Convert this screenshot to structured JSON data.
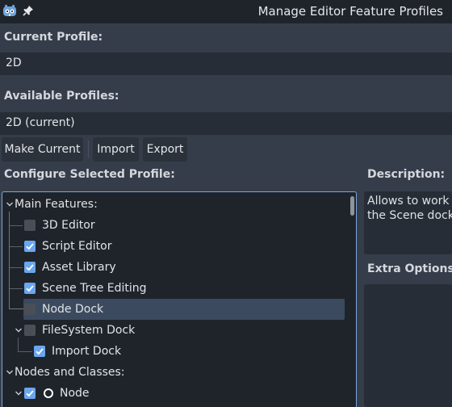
{
  "window": {
    "title": "Manage Editor Feature Profiles",
    "app_icon": "godot-icon",
    "pin_icon": "pin-icon"
  },
  "current_profile": {
    "label": "Current Profile:",
    "value": "2D"
  },
  "available_profiles": {
    "label": "Available Profiles:",
    "selected": "2D (current)",
    "buttons": {
      "make_current": "Make Current",
      "import": "Import",
      "export": "Export"
    }
  },
  "configure": {
    "label": "Configure Selected Profile:",
    "tree": [
      {
        "label": "Main Features:",
        "type": "section",
        "expanded": true
      },
      {
        "label": "3D Editor",
        "checked": false
      },
      {
        "label": "Script Editor",
        "checked": true
      },
      {
        "label": "Asset Library",
        "checked": true
      },
      {
        "label": "Scene Tree Editing",
        "checked": true
      },
      {
        "label": "Node Dock",
        "checked": false,
        "selected": true
      },
      {
        "label": "FileSystem Dock",
        "checked": false,
        "expanded": true
      },
      {
        "label": "Import Dock",
        "checked": true
      },
      {
        "label": "Nodes and Classes:",
        "type": "section",
        "expanded": true
      },
      {
        "label": "Node",
        "checked": true,
        "icon": "node-circle-icon",
        "expanded": true
      }
    ]
  },
  "description": {
    "label": "Description:",
    "text_line1": "Allows to work w",
    "text_line2": "the Scene dock."
  },
  "extra_options": {
    "label": "Extra Options:"
  },
  "colors": {
    "accent": "#6ba6ee",
    "panel_bg": "#363d4a",
    "field_bg": "#272d36",
    "tree_bg": "#1f242b",
    "selected_row": "#3b4a5e"
  }
}
